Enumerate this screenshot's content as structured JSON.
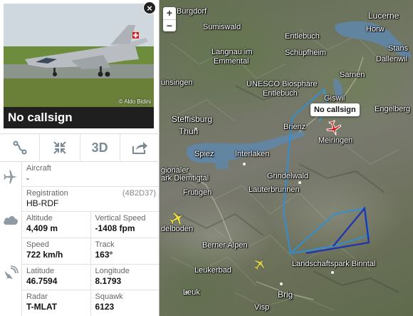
{
  "map": {
    "zoom_in": "+",
    "zoom_out": "−",
    "callout": "No callsign",
    "places": [
      {
        "id": "burgdorf",
        "text": "Burgdorf"
      },
      {
        "id": "sumiswald",
        "text": "Sumiswald"
      },
      {
        "id": "lucerne",
        "text": "Lucerne"
      },
      {
        "id": "horw",
        "text": "Horw"
      },
      {
        "id": "stans",
        "text": "Stans"
      },
      {
        "id": "entlebuch1",
        "text": "Entlebuch"
      },
      {
        "id": "langnau",
        "text": "Langnau im"
      },
      {
        "id": "emmental",
        "text": "Emmental"
      },
      {
        "id": "schupfheim",
        "text": "Schüpfheim"
      },
      {
        "id": "dallenwil",
        "text": "Dallenwil"
      },
      {
        "id": "unesco",
        "text": "UNESCO Biosphäre"
      },
      {
        "id": "entlebuch2",
        "text": "Entlebuch"
      },
      {
        "id": "sarnen",
        "text": "Sarnen"
      },
      {
        "id": "munsingen",
        "text": "ünsingen"
      },
      {
        "id": "giswil",
        "text": "Giswil"
      },
      {
        "id": "engelberg",
        "text": "Engelberg"
      },
      {
        "id": "steffisburg",
        "text": "Steffisburg"
      },
      {
        "id": "thun",
        "text": "Thun"
      },
      {
        "id": "brienz",
        "text": "Brienz"
      },
      {
        "id": "meiringen",
        "text": "Meiringen"
      },
      {
        "id": "spiez",
        "text": "Spiez"
      },
      {
        "id": "interlaken",
        "text": "Interlaken"
      },
      {
        "id": "grindelwald",
        "text": "Grindelwald"
      },
      {
        "id": "gionaler",
        "text": "gionaler"
      },
      {
        "id": "diemtigtal",
        "text": "ark Diemtigtal"
      },
      {
        "id": "lauterbrunnen",
        "text": "Lauterbrunnen"
      },
      {
        "id": "frutigen",
        "text": "Frutigen"
      },
      {
        "id": "adelboden",
        "text": "delboden"
      },
      {
        "id": "berneralpen",
        "text": "Berner Alpen"
      },
      {
        "id": "leukerbad",
        "text": "Leukerbad"
      },
      {
        "id": "landschaftspark",
        "text": "Landschaftspark Binntal"
      },
      {
        "id": "leuk",
        "text": "Leuk"
      },
      {
        "id": "brig",
        "text": "Brig"
      },
      {
        "id": "visp",
        "text": "Visp"
      }
    ]
  },
  "photo": {
    "credit": "© Aldo Bidini"
  },
  "header": {
    "close": "×",
    "callsign": "No callsign"
  },
  "toolbar": {
    "three_d": "3D"
  },
  "aircraft": {
    "aircraft_label": "Aircraft",
    "aircraft_value": "-",
    "registration_label": "Registration",
    "registration_hex": "(4B2D37)",
    "registration_value": "HB-RDF"
  },
  "flight": {
    "altitude_label": "Altitude",
    "altitude_value": "4,409 m",
    "vspeed_label": "Vertical Speed",
    "vspeed_value": "-1408 fpm",
    "speed_label": "Speed",
    "speed_value": "722 km/h",
    "track_label": "Track",
    "track_value": "163°"
  },
  "position": {
    "lat_label": "Latitude",
    "lat_value": "46.7594",
    "lon_label": "Longitude",
    "lon_value": "8.1793",
    "radar_label": "Radar",
    "radar_value": "T-MLAT",
    "squawk_label": "Squawk",
    "squawk_value": "6123"
  },
  "colors": {
    "panel_bg": "#ffffff",
    "callsign_bar": "#1f1f1f",
    "track_light": "#2e8fd8",
    "track_dark": "#1a2fb5",
    "selected_plane": "#d11a1a",
    "other_plane": "#f3e33a",
    "lake": "#5f86a8"
  },
  "icons": [
    "close-icon",
    "route-icon",
    "compress-icon",
    "share-icon",
    "plane-icon",
    "cloud-icon",
    "radar-icon"
  ]
}
